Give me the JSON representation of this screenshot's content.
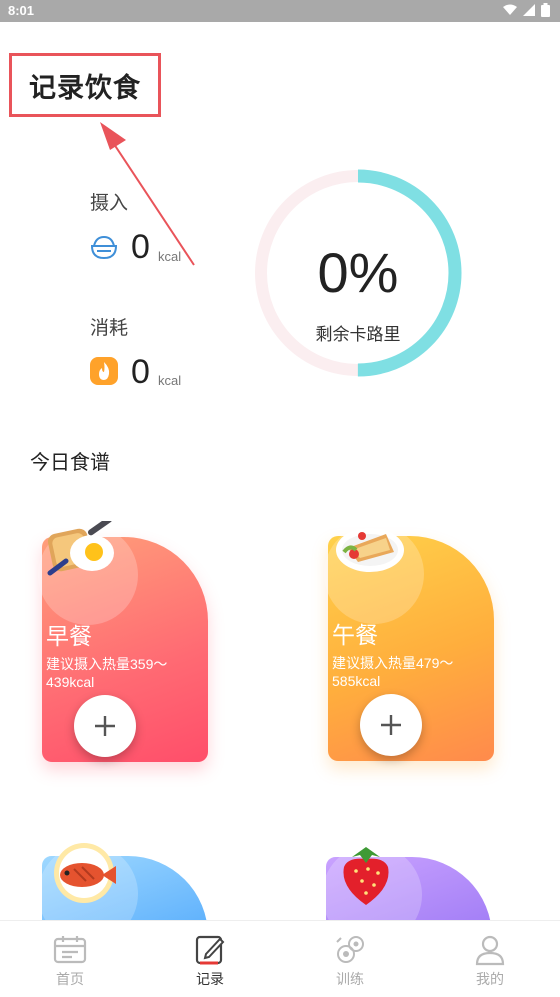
{
  "status_bar": {
    "time": "8:01",
    "icons": [
      "wifi-icon",
      "cell-signal-icon",
      "battery-icon"
    ]
  },
  "page": {
    "title": "记录饮食"
  },
  "stats": {
    "intake": {
      "label": "摄入",
      "value": "0",
      "unit": "kcal",
      "icon": "rice-bowl-icon"
    },
    "burned": {
      "label": "消耗",
      "value": "0",
      "unit": "kcal",
      "icon": "flame-icon"
    }
  },
  "ring": {
    "percent_text": "0%",
    "caption": "剩余卡路里",
    "fill_fraction": 0.5,
    "fill_color": "#7fdfe3",
    "track_color": "#fbeef0"
  },
  "recipes": {
    "title": "今日食谱",
    "meals": [
      {
        "name": "早餐",
        "hint": "建议摄入热量359～439kcal",
        "image": "fried-egg-toast-icon"
      },
      {
        "name": "午餐",
        "hint": "建议摄入热量479～585kcal",
        "image": "sandwich-plate-icon"
      },
      {
        "name": "",
        "hint": "",
        "image": "fish-plate-icon"
      },
      {
        "name": "",
        "hint": "",
        "image": "strawberry-icon"
      }
    ]
  },
  "nav": {
    "items": [
      {
        "label": "首页",
        "icon": "calendar-icon",
        "active": false
      },
      {
        "label": "记录",
        "icon": "edit-notebook-icon",
        "active": true
      },
      {
        "label": "训练",
        "icon": "dumbbell-icon",
        "active": false
      },
      {
        "label": "我的",
        "icon": "user-icon",
        "active": false
      }
    ]
  },
  "colors": {
    "accent_red": "#e9545a",
    "ring": "#7fdfe3",
    "breakfast": "#ff6a73",
    "lunch": "#ffae3d"
  }
}
